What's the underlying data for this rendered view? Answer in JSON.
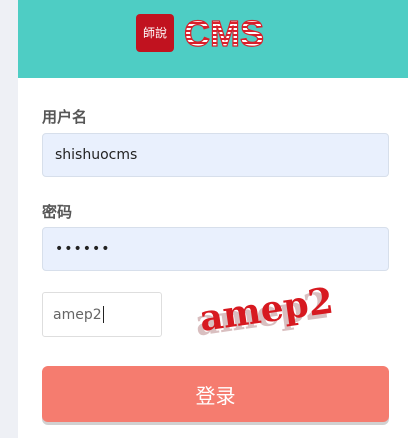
{
  "brand": {
    "seal_text": "師說",
    "wordmark": "CMS"
  },
  "form": {
    "username_label": "用户名",
    "username_value": "shishuocms",
    "password_label": "密码",
    "password_value": "••••••",
    "captcha_value": "amep2",
    "captcha_image_text": "amep2",
    "submit_label": "登录"
  },
  "colors": {
    "header": "#4ecdc4",
    "logo_red": "#c1121f",
    "input_bg": "#e9f0fd",
    "button": "#f57c6f"
  }
}
